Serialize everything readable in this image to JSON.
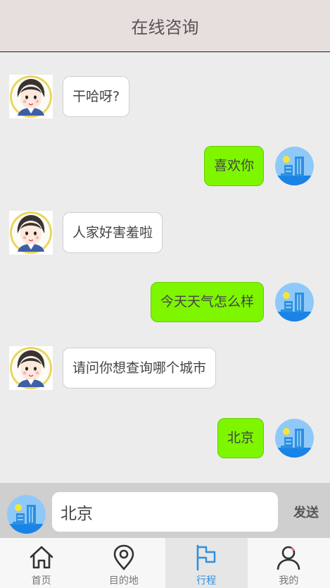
{
  "header": {
    "title": "在线咨询"
  },
  "messages": [
    {
      "side": "left",
      "text": "干哈呀?"
    },
    {
      "side": "right",
      "text": "喜欢你"
    },
    {
      "side": "left",
      "text": "人家好害羞啦"
    },
    {
      "side": "right",
      "text": "今天天气怎么样"
    },
    {
      "side": "left",
      "text": "请问你想查询哪个城市"
    },
    {
      "side": "right",
      "text": "北京"
    }
  ],
  "input": {
    "value": "北京",
    "send_label": "发送"
  },
  "tabs": [
    {
      "label": "首页",
      "icon": "home-icon",
      "active": false
    },
    {
      "label": "目的地",
      "icon": "location-pin-icon",
      "active": false
    },
    {
      "label": "行程",
      "icon": "flag-icon",
      "active": true
    },
    {
      "label": "我的",
      "icon": "user-icon",
      "active": false
    }
  ],
  "colors": {
    "header_bg": "#e7dfdd",
    "user_bubble": "#7df600",
    "active_tab": "#2f8fe0"
  }
}
